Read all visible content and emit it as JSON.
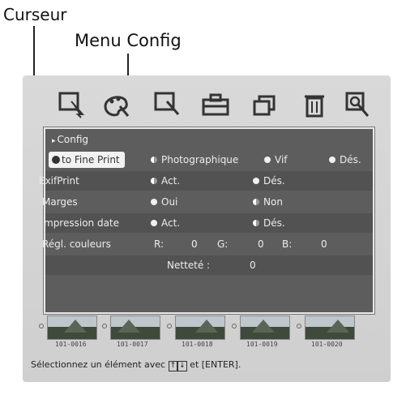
{
  "callouts": {
    "cursor": "Curseur",
    "menu": "Menu Config"
  },
  "toolbar": {
    "icons": [
      "magnifier-cursor-icon",
      "palette-icon",
      "magnifier-cursor-icon",
      "toolbox-icon",
      "layers-icon",
      "trash-icon",
      "zoom-icon"
    ]
  },
  "config_panel": {
    "title": "Config",
    "rows": [
      {
        "label": "to Fine Print",
        "options": [
          "Photographique",
          "Vif",
          "Dés."
        ]
      },
      {
        "label": "ExifPrint",
        "options": [
          "Act.",
          "Dés."
        ]
      },
      {
        "label": "Marges",
        "options": [
          "Oui",
          "Non"
        ]
      },
      {
        "label": "mpression date",
        "options": [
          "Act.",
          "Dés."
        ]
      },
      {
        "label": "Régl. couleurs",
        "r_label": "R:",
        "r_value": "0",
        "g_label": "G:",
        "g_value": "0",
        "b_label": "B:",
        "b_value": "0"
      },
      {
        "sharpness_label": "Netteté :",
        "sharpness_value": "0"
      }
    ]
  },
  "thumbnails": [
    "101-0016",
    "101-0017",
    "101-0018",
    "101-0019",
    "101-0020"
  ],
  "status": {
    "prefix": "Sélectionnez un élément avec",
    "key_up": "↑",
    "key_down": "↓",
    "suffix": "et [ENTER]."
  }
}
